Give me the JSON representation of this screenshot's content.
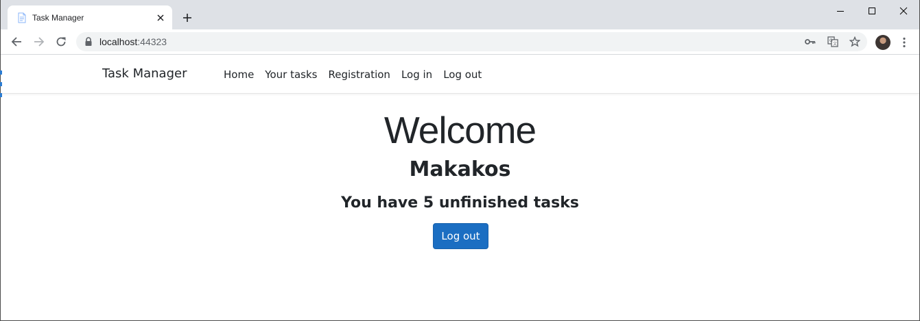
{
  "browser": {
    "tab_title": "Task Manager",
    "url_host": "localhost",
    "url_port": ":44323",
    "accent_color": "#dee1e6"
  },
  "navbar": {
    "brand": "Task Manager",
    "links": [
      "Home",
      "Your tasks",
      "Registration",
      "Log in",
      "Log out"
    ]
  },
  "main": {
    "heading": "Welcome",
    "username": "Makakos",
    "tasks_message": "You have 5 unfinished tasks",
    "logout_button": "Log out",
    "button_color": "#1b6ec2"
  },
  "icons": {
    "tab_favicon": "page-icon",
    "tab_close": "close-icon",
    "new_tab": "plus-icon",
    "minimize": "minimize-icon",
    "maximize": "maximize-icon",
    "close_window": "close-icon",
    "back": "back-arrow-icon",
    "forward": "forward-arrow-icon",
    "reload": "reload-icon",
    "lock": "lock-icon",
    "key": "key-icon",
    "translate": "translate-icon",
    "bookmark": "star-icon",
    "profile": "avatar",
    "menu": "more-vert-icon"
  }
}
